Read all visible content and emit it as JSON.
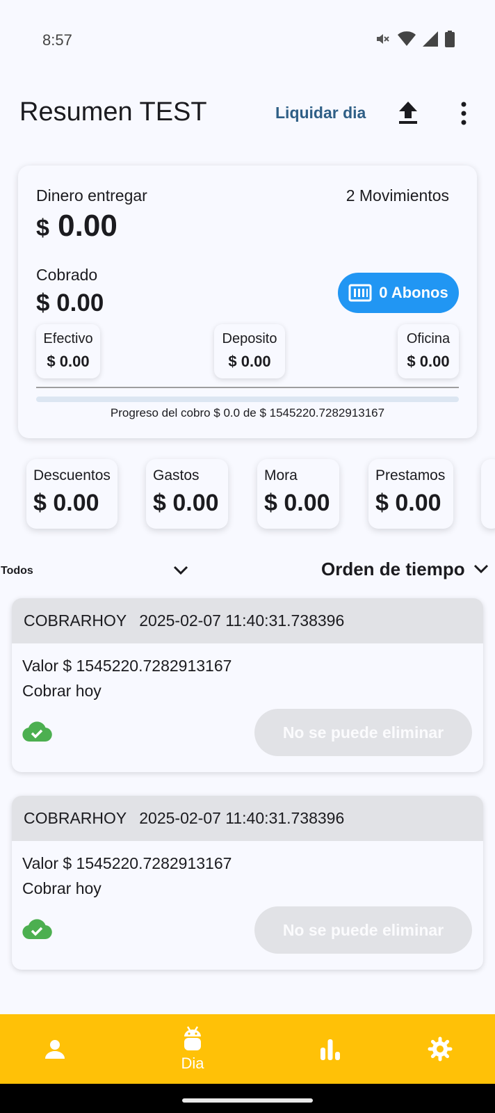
{
  "status_bar": {
    "time": "8:57",
    "icons": [
      "mute-icon",
      "wifi-icon",
      "signal-icon",
      "battery-icon"
    ]
  },
  "app_bar": {
    "title": "Resumen TEST",
    "liquidar_label": "Liquidar dia",
    "icons": [
      "upload-icon",
      "more-vert-icon"
    ]
  },
  "summary": {
    "dinero_label": "Dinero entregar",
    "movimientos": "2 Movimientos",
    "dinero_currency": "$",
    "dinero_value": "0.00",
    "cobrado_label": "Cobrado",
    "cobrado_value": "$ 0.00",
    "abonos_label": "0 Abonos",
    "efectivo": {
      "label": "Efectivo",
      "value": "$ 0.00"
    },
    "deposito": {
      "label": "Deposito",
      "value": "$ 0.00"
    },
    "oficina": {
      "label": "Oficina",
      "value": "$ 0.00"
    },
    "progress_fraction": 0,
    "progress_text": "Progreso del cobro $ 0.0 de $ 1545220.7282913167"
  },
  "stats": [
    {
      "label": "Descuentos",
      "value": "$ 0.00"
    },
    {
      "label": "Gastos",
      "value": "$ 0.00"
    },
    {
      "label": "Mora",
      "value": "$ 0.00"
    },
    {
      "label": "Prestamos",
      "value": "$ 0.00"
    }
  ],
  "filters": {
    "type_selected": "Todos",
    "order_selected": "Orden de tiempo"
  },
  "movements": [
    {
      "type": "COBRARHOY",
      "timestamp": "2025-02-07 11:40:31.738396",
      "valor": "Valor $ 1545220.7282913167",
      "description": "Cobrar hoy",
      "delete_label": "No se puede eliminar"
    },
    {
      "type": "COBRARHOY",
      "timestamp": "2025-02-07 11:40:31.738396",
      "valor": "Valor $ 1545220.7282913167",
      "description": "Cobrar hoy",
      "delete_label": "No se puede eliminar"
    }
  ],
  "bottom_nav": {
    "active_label": "Dia",
    "items": [
      "person-icon",
      "android-icon",
      "bar-chart-icon",
      "gear-icon"
    ]
  },
  "colors": {
    "accent_blue": "#2196f3",
    "nav_yellow": "#ffc107",
    "title_blue": "#2f5f86",
    "sync_green": "#4caf50"
  }
}
